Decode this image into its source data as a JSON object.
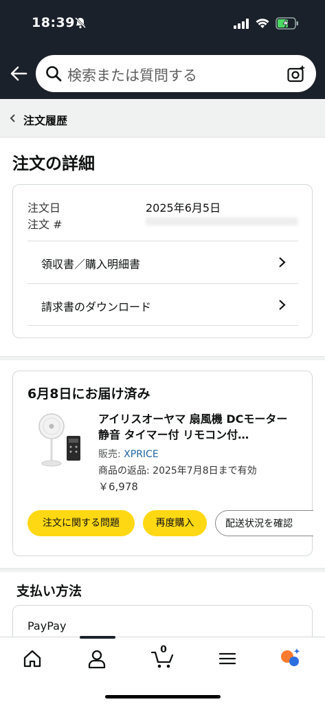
{
  "status_bar": {
    "time": "18:39"
  },
  "search": {
    "placeholder": "検索または質問する"
  },
  "breadcrumb": {
    "label": "注文履歴"
  },
  "page": {
    "title": "注文の詳細"
  },
  "order_info": {
    "date_label": "注文日",
    "date_value": "2025年6月5日",
    "number_label": "注文 #",
    "rows": [
      {
        "label": "領収書／購入明細書"
      },
      {
        "label": "請求書のダウンロード"
      }
    ]
  },
  "delivery": {
    "heading": "6月8日にお届け済み",
    "product_title": "アイリスオーヤマ 扇風機 DCモーター 静音 タイマー付 リモコン付…",
    "seller_label": "販売:",
    "seller_name": "XPRICE",
    "return_text": "商品の返品: 2025年7月8日まで有効",
    "price": "￥6,978",
    "buttons": {
      "problem": "注文に関する問題",
      "rebuy": "再度購入",
      "track": "配送状況を確認"
    }
  },
  "payment": {
    "heading": "支払い方法",
    "method": "PayPay"
  },
  "tabbar": {
    "cart_count": "0"
  },
  "colors": {
    "header_bg": "#1b212a",
    "button_yellow": "#ffd814",
    "link_blue": "#2162a1"
  }
}
